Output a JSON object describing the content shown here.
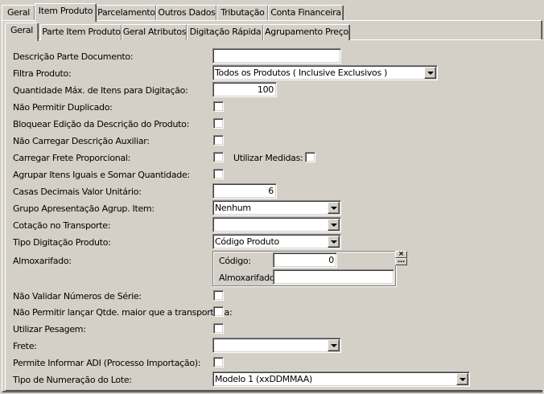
{
  "top_tabs": [
    "Geral",
    "Item Produto",
    "Parcelamento",
    "Outros Dados",
    "Tributação",
    "Conta Financeira"
  ],
  "sub_tabs": [
    "Geral",
    "Parte Item Produto",
    "Geral Atributos",
    "Digitação Rápida",
    "Agrupamento Preço"
  ],
  "form": {
    "descricao_parte_label": "Descrição Parte Documento:",
    "descricao_parte_value": "",
    "filtra_produto_label": "Filtra Produto:",
    "filtra_produto_value": "Todos os Produtos ( Inclusive Exclusivos )",
    "qtd_max_label": "Quantidade Máx. de Itens para Digitação:",
    "qtd_max_value": "100",
    "nao_permitir_duplicado_label": "Não Permitir Duplicado:",
    "bloquear_edicao_label": "Bloquear Edição da Descrição do Produto:",
    "nao_carregar_desc_label": "Não Carregar Descrição Auxiliar:",
    "carregar_frete_label": "Carregar Frete Proporcional:",
    "utilizar_medidas_label": "Utilizar Medidas:",
    "agrupar_itens_label": "Agrupar Itens Iguais e Somar Quantidade:",
    "casas_decimais_label": "Casas Decimais Valor Unitário:",
    "casas_decimais_value": "6",
    "grupo_apresentacao_label": "Grupo Apresentação Agrup. Item:",
    "grupo_apresentacao_value": "Nenhum",
    "cotacao_label": "Cotação no Transporte:",
    "cotacao_value": "",
    "tipo_digitacao_label": "Tipo Digitação Produto:",
    "tipo_digitacao_value": "Código Produto",
    "almoxarifado_label": "Almoxarifado:",
    "almox_codigo_label": "Código:",
    "almox_codigo_value": "0",
    "almox_nome_label": "Almoxarifado:",
    "almox_nome_value": "",
    "nao_validar_serie_label": "Não Validar Números de Série:",
    "nao_permitir_qtde_label": "Não Permitir lançar Qtde. maior que a transportada:",
    "utilizar_pesagem_label": "Utilizar Pesagem:",
    "frete_label": "Frete:",
    "frete_value": "",
    "permite_adi_label": "Permite Informar ADI (Processo Importação):",
    "tipo_numeracao_label": "Tipo de Numeração do Lote:",
    "tipo_numeracao_value": "Modelo 1 (xxDDMMAA)"
  }
}
